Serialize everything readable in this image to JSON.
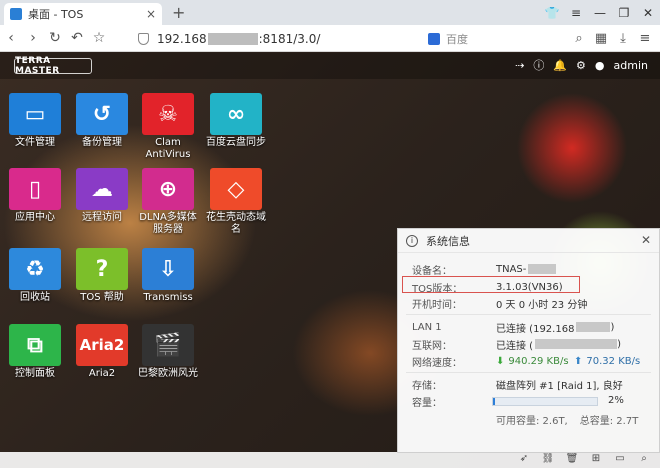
{
  "browser": {
    "tab_title": "桌面 - TOS",
    "tab_close": "×",
    "new_tab": "+",
    "url_prefix": "192.168",
    "url_suffix": ":8181/3.0/",
    "search_placeholder": "百度"
  },
  "topbar": {
    "logo_text": "TERRA MASTER",
    "user": "admin"
  },
  "apps": [
    {
      "label": "文件管理",
      "color": "#1f7fd8",
      "glyph": "▭"
    },
    {
      "label": "备份管理",
      "color": "#2a88e0",
      "glyph": "↺"
    },
    {
      "label": "Clam AntiVirus",
      "color": "#e2232a",
      "glyph": "☠"
    },
    {
      "label": "百度云盘同步",
      "color": "#22b3c7",
      "glyph": "∞"
    },
    {
      "label": "应用中心",
      "color": "#d92a8c",
      "glyph": "▯"
    },
    {
      "label": "远程访问",
      "color": "#8a3bc6",
      "glyph": "☁"
    },
    {
      "label": "DLNA多媒体服务器",
      "color": "#d22c8e",
      "glyph": "⊕"
    },
    {
      "label": "花生壳动态域名",
      "color": "#ef4b2a",
      "glyph": "◇"
    },
    {
      "label": "回收站",
      "color": "#2d89dc",
      "glyph": "♻"
    },
    {
      "label": "TOS 帮助",
      "color": "#7cbf2a",
      "glyph": "?"
    },
    {
      "label": "Transmiss",
      "color": "#2c7fd6",
      "glyph": "⇩"
    },
    {
      "label": "控制面板",
      "color": "#2db54a",
      "glyph": "⧉"
    },
    {
      "label": "Aria2",
      "color": "#e23a2a",
      "glyph": "Aria2"
    },
    {
      "label": "巴黎欧洲风光",
      "color": "#333333",
      "glyph": "🎬"
    }
  ],
  "sysinfo": {
    "title": "系统信息",
    "device_name_label": "设备名：",
    "device_name_value": "TNAS-",
    "tos_version_label": "TOS版本：",
    "tos_version_value": "3.1.03(VN36)",
    "uptime_label": "开机时间：",
    "uptime_value": "0 天 0 小时 23 分钟",
    "lan_label": "LAN 1",
    "lan_value": "已连接 (192.168",
    "internet_label": "互联网：",
    "internet_value": "已连接 (",
    "speed_label": "网络速度：",
    "download_speed": "940.29 KB/s",
    "upload_speed": "70.32 KB/s",
    "storage_label": "存储：",
    "storage_value": "磁盘阵列 #1 [Raid 1], 良好",
    "capacity_label": "容量：",
    "capacity_percent": "2%",
    "capacity_fraction": 0.02,
    "available": "可用容量: 2.6T,",
    "total": "总容量: 2.7T"
  }
}
